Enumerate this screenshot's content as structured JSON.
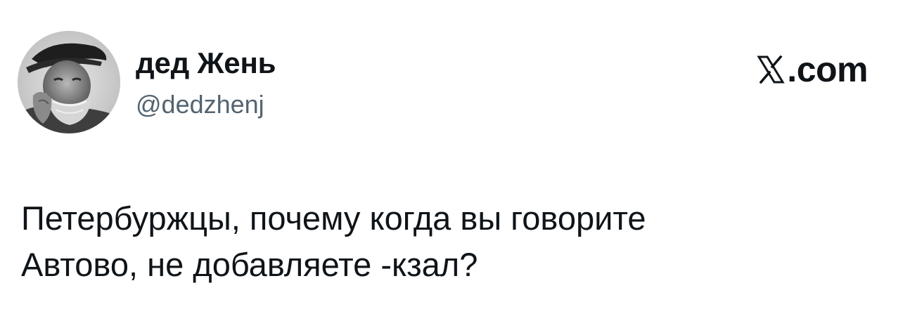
{
  "author": {
    "display_name": "дед Жень",
    "handle": "@dedzhenj",
    "avatar": "grayscale-portrait-elderly-man-with-beard-and-cap"
  },
  "brand": {
    "icon": "x-logo-icon",
    "suffix": ".com"
  },
  "tweet": {
    "lines": [
      "Петербуржцы, почему когда вы говорите",
      "Автово, не добавляете -кзал?"
    ]
  },
  "colors": {
    "text": "#0f1419",
    "secondary_text": "#536471",
    "background": "#ffffff"
  }
}
